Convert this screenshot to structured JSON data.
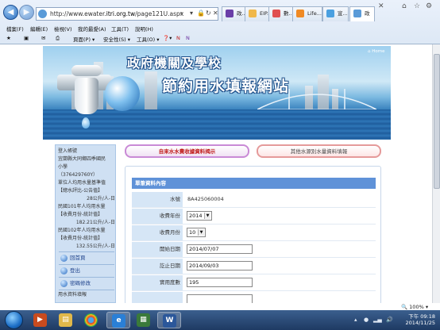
{
  "browser": {
    "url_prefix": "http://www.ewater.",
    "url_domain": "itri.org.tw",
    "url_path": "/page121U.aspx",
    "tabs": [
      {
        "label": "政...",
        "color": "#e6c33a"
      },
      {
        "label": "EIP...",
        "color": "#f0b84a"
      },
      {
        "label": "數...",
        "color": "#e05050"
      },
      {
        "label": "Life...",
        "color": "#f08a24"
      },
      {
        "label": "宣...",
        "color": "#4aa0e0"
      },
      {
        "label": "政",
        "color": "#5a9bd8"
      }
    ],
    "menu": [
      "檔案(F)",
      "編輯(E)",
      "檢視(V)",
      "我的最愛(A)",
      "工具(T)",
      "說明(H)"
    ],
    "toolbar": {
      "page": "頁面(P) ▾",
      "safety": "安全性(S) ▾",
      "tools": "工具(O) ▾",
      "help": "❓▾"
    },
    "zoom": "100%"
  },
  "banner": {
    "title_line1": "政府機關及學校",
    "title_line2": "節約用水填報網站",
    "home_link": "Home"
  },
  "sidebar": {
    "lines": [
      "登入帳號",
      "宜蘭縣大同鄉四季國民",
      "小學",
      "（376429760Y）",
      "單位人均用水量基準值",
      "【總水評比-公告值】",
      "28公升/人-日",
      "民國101年人均用水量",
      "【收費月份-統計值】",
      "182.21公升/人-日",
      "民國102年人均用水量",
      "【收費月份-統計值】",
      "132.55公升/人-日"
    ],
    "links": [
      "回首頁",
      "登出",
      "密碼修改"
    ],
    "footer_text": "用水資料填報"
  },
  "tabs": {
    "active": "自來水水費收據資料揭示",
    "other": "其他水源別水量資料填報"
  },
  "panel": {
    "header": "單筆資料內容",
    "fields": {
      "water_no_label": "水號",
      "water_no_value": "8A425060004",
      "year_label": "收費年份",
      "year_value": "2014",
      "month_label": "收費月份",
      "month_value": "10",
      "start_label": "開始日期",
      "start_value": "2014/07/07",
      "end_label": "訖止日期",
      "end_value": "2014/09/03",
      "usage_label": "實用度數",
      "usage_value": "195"
    }
  },
  "taskbar": {
    "ampm": "下午 09:18",
    "date": "2014/11/25"
  }
}
